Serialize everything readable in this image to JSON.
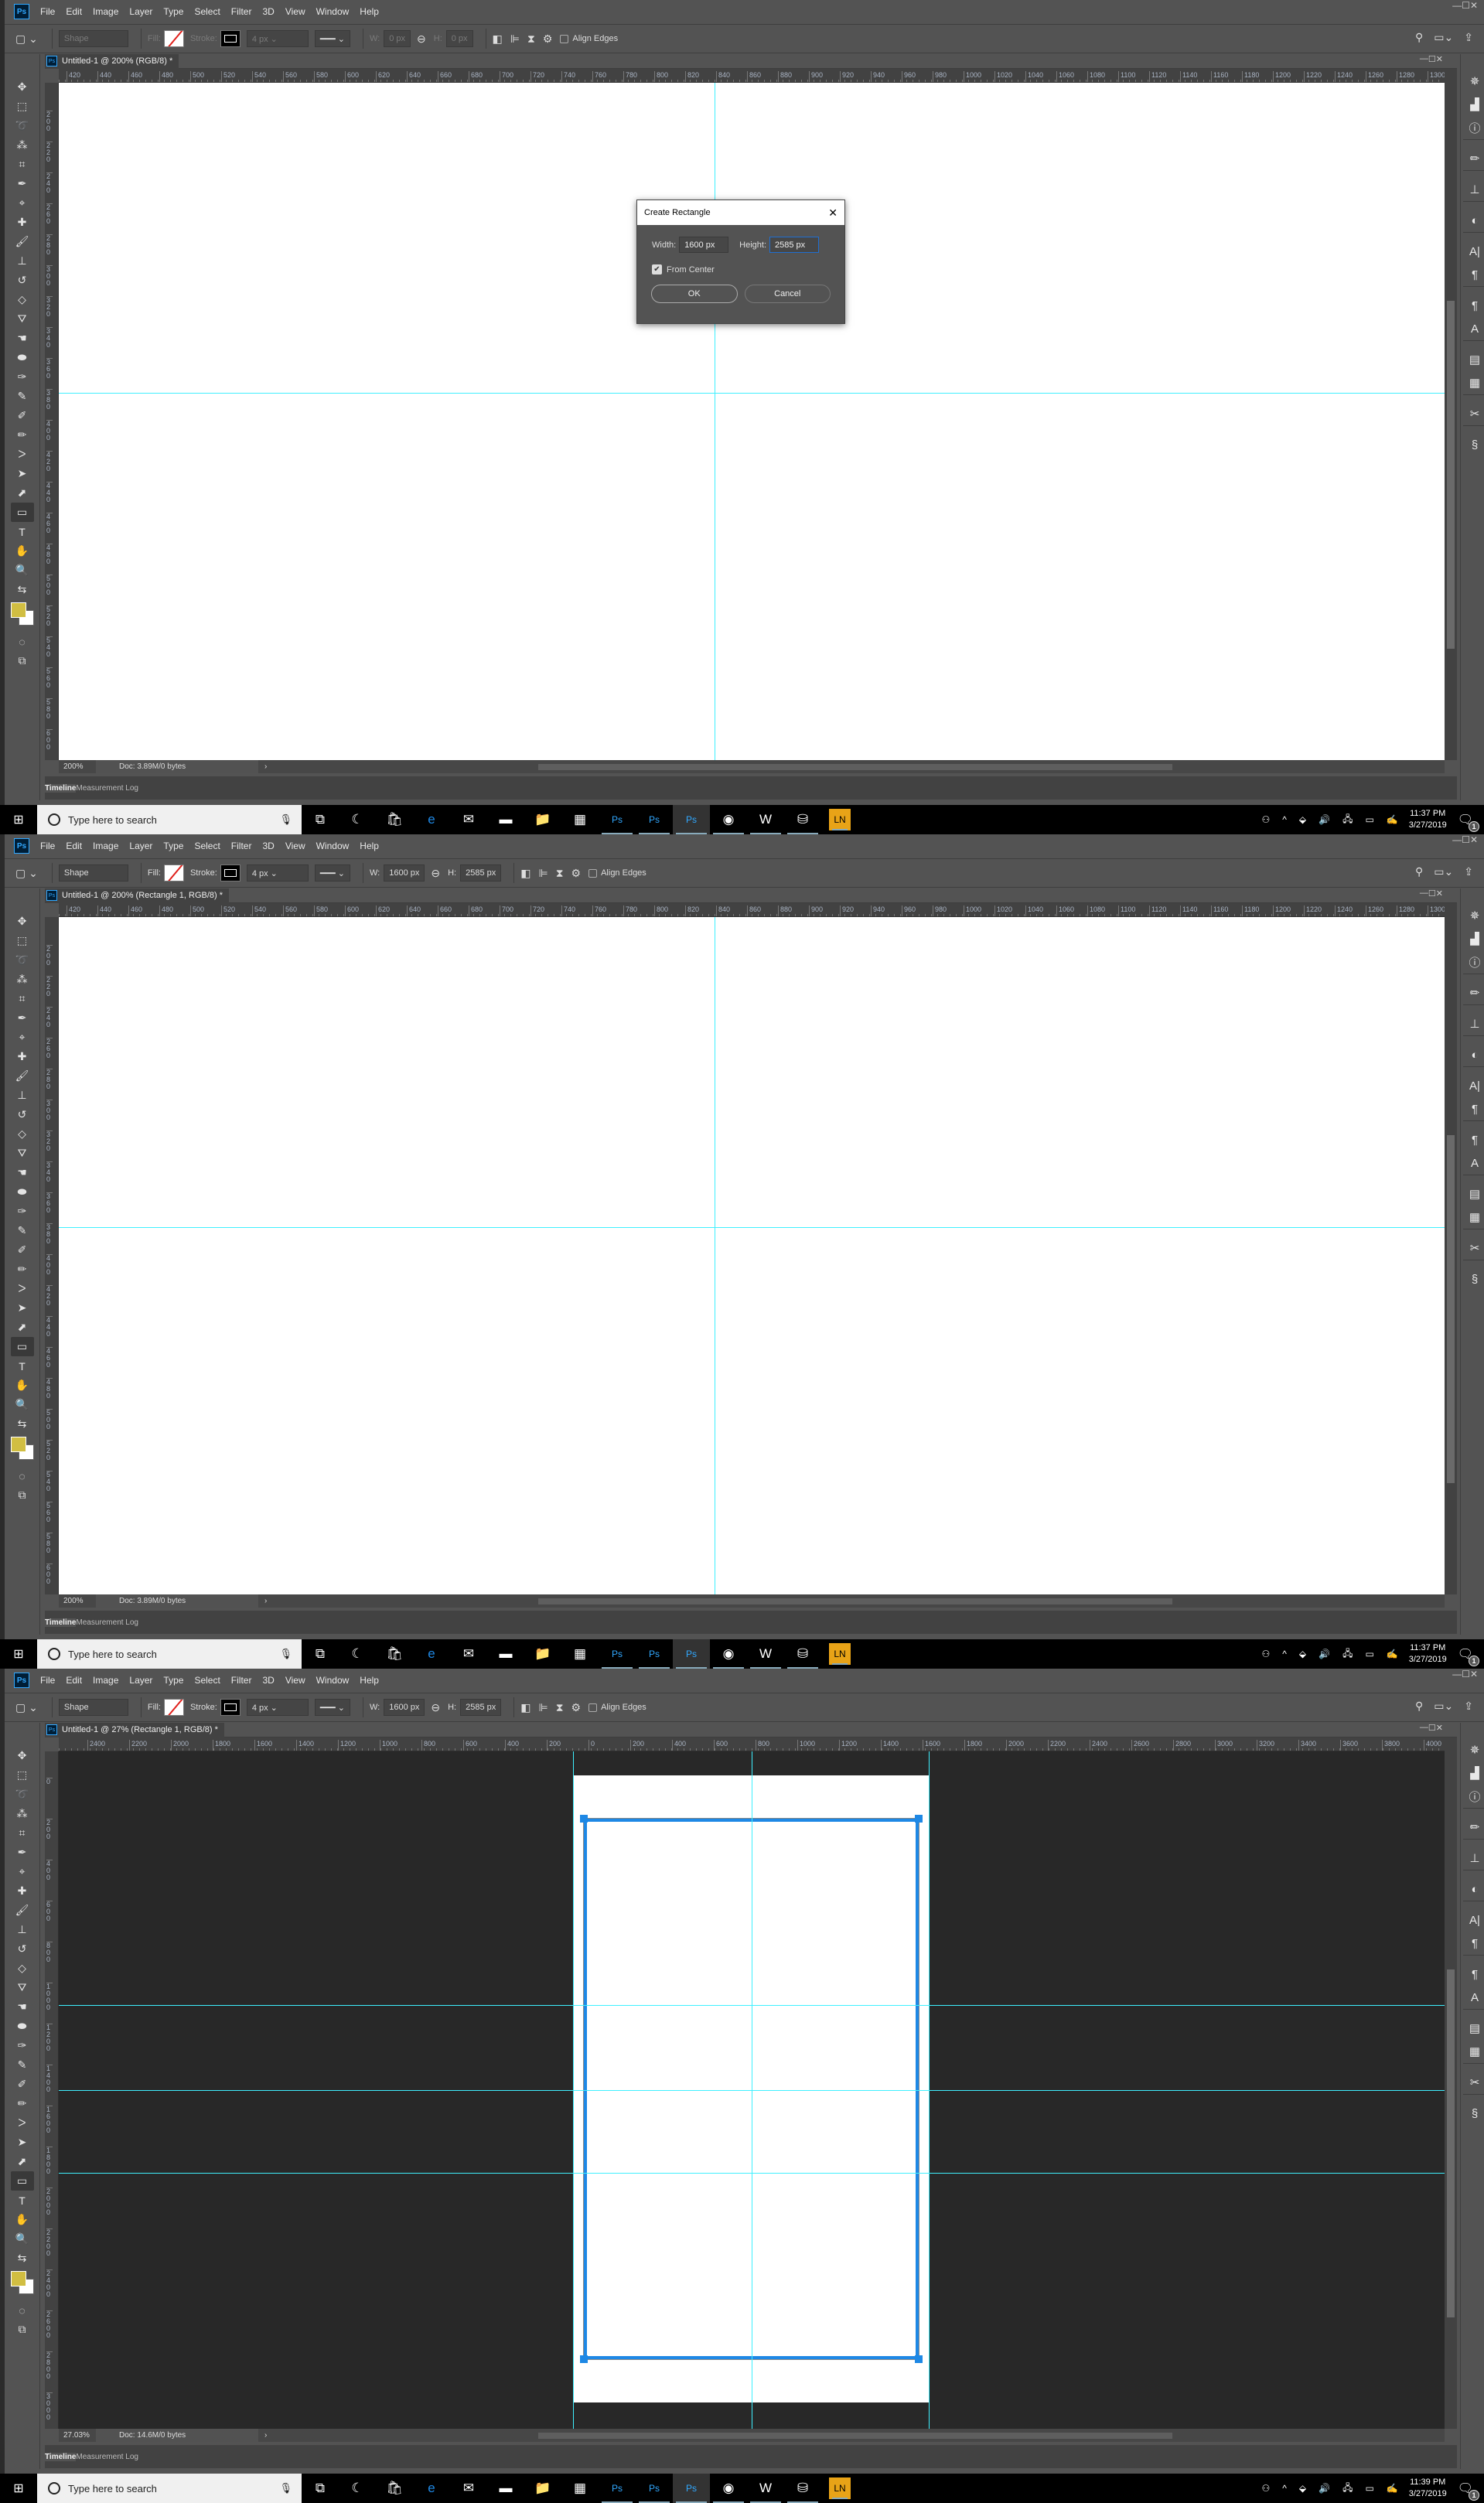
{
  "app": {
    "menu": [
      "File",
      "Edit",
      "Image",
      "Layer",
      "Type",
      "Select",
      "Filter",
      "3D",
      "View",
      "Window",
      "Help"
    ],
    "logo": "Ps",
    "options": {
      "fill_label": "Fill:",
      "stroke_label": "Stroke:",
      "w_label": "W:",
      "h_label": "H:",
      "align_edges": "Align Edges"
    },
    "tools": [
      {
        "icon": "move-icon",
        "glyph": "✥"
      },
      {
        "icon": "rectangular-marquee-icon",
        "glyph": "⬚"
      },
      {
        "icon": "lasso-icon",
        "glyph": "➰"
      },
      {
        "icon": "magic-wand-icon",
        "glyph": "⁂"
      },
      {
        "icon": "crop-icon",
        "glyph": "⌗"
      },
      {
        "icon": "eyedropper-icon",
        "glyph": "✒"
      },
      {
        "icon": "color-sampler-icon",
        "glyph": "⌖"
      },
      {
        "icon": "healing-brush-icon",
        "glyph": "✚"
      },
      {
        "icon": "brush-icon",
        "glyph": "🖌"
      },
      {
        "icon": "clone-stamp-icon",
        "glyph": "⊥"
      },
      {
        "icon": "history-brush-icon",
        "glyph": "↺"
      },
      {
        "icon": "eraser-icon",
        "glyph": "◇"
      },
      {
        "icon": "paint-bucket-icon",
        "glyph": "⛛"
      },
      {
        "icon": "smudge-icon",
        "glyph": "☚"
      },
      {
        "icon": "sponge-icon",
        "glyph": "⬬"
      },
      {
        "icon": "pen-icon",
        "glyph": "✑"
      },
      {
        "icon": "freeform-pen-icon",
        "glyph": "✎"
      },
      {
        "icon": "add-anchor-icon",
        "glyph": "✐"
      },
      {
        "icon": "delete-anchor-icon",
        "glyph": "✏"
      },
      {
        "icon": "convert-point-icon",
        "glyph": "ᐳ"
      },
      {
        "icon": "path-selection-icon",
        "glyph": "➤"
      },
      {
        "icon": "direct-selection-icon",
        "glyph": "⬈"
      },
      {
        "icon": "rectangle-tool-icon",
        "glyph": "▭",
        "active": true
      },
      {
        "icon": "type-tool-icon",
        "glyph": "T"
      },
      {
        "icon": "hand-icon",
        "glyph": "✋"
      },
      {
        "icon": "zoom-icon",
        "glyph": "🔍"
      },
      {
        "icon": "swap-colors-icon",
        "glyph": "⇆"
      }
    ],
    "extra_tools": [
      {
        "icon": "quick-mask-icon",
        "glyph": "◌"
      },
      {
        "icon": "screen-mode-icon",
        "glyph": "⧉"
      }
    ],
    "colors": {
      "foreground": "#d1be42",
      "background": "#ffffff",
      "guide": "#3ff0ff",
      "path": "#1e88e5",
      "ui": "#535353",
      "pasteboard": "#282828"
    },
    "dock": [
      [
        "navigator-icon",
        "✵"
      ],
      [
        "histogram-icon",
        "▟"
      ],
      [
        "info-icon",
        "ⓘ"
      ],
      null,
      [
        "brush-presets-icon",
        "✏"
      ],
      null,
      [
        "clone-source-icon",
        "⊥"
      ],
      null,
      [
        "adjustments-icon",
        "◐"
      ],
      null,
      [
        "character-icon",
        "A|"
      ],
      [
        "paragraph-icon",
        "¶"
      ],
      null,
      [
        "paragraph-styles-icon",
        "¶"
      ],
      [
        "character-styles-icon",
        "A"
      ],
      null,
      [
        "libraries-icon",
        "▤"
      ],
      [
        "notes-icon",
        "▦"
      ],
      null,
      [
        "tool-presets-icon",
        "✂"
      ],
      null,
      [
        "history-icon",
        "§"
      ]
    ],
    "timeline_tabs": [
      "Timeline",
      "Measurement Log"
    ]
  },
  "taskbar": {
    "search_placeholder": "Type here to search",
    "apps": [
      "task-view",
      "cortana-app",
      "store",
      "edge",
      "mail",
      "terminal",
      "file-explorer",
      "calculator",
      "photoshop-1",
      "photoshop-2",
      "photoshop-3",
      "chrome",
      "word-app",
      "network-app",
      "lightroom"
    ],
    "tray": [
      "people",
      "show-hidden",
      "dropbox",
      "volume",
      "network",
      "battery",
      "pen"
    ],
    "notification_count": "1"
  },
  "shots": [
    {
      "doc_title": "Untitled-1 @ 200% (RGB/8) *",
      "shape_mode": "Shape",
      "stroke_width": "4 px",
      "w": "0 px",
      "h": "0 px",
      "options_disabled": true,
      "zoom": "200%",
      "doc_info": "Doc: 3.89M/0 bytes",
      "hruler": [
        "420",
        "440",
        "460",
        "480",
        "500",
        "520",
        "540",
        "560",
        "580",
        "600",
        "620",
        "640",
        "660",
        "680",
        "700",
        "720",
        "740",
        "760",
        "780",
        "800",
        "820",
        "840",
        "860",
        "880",
        "900",
        "920",
        "940",
        "960",
        "980",
        "1000",
        "1020",
        "1040",
        "1060",
        "1080",
        "1100",
        "1120",
        "1140",
        "1160",
        "1180",
        "1200",
        "1220",
        "1240",
        "1260",
        "1280",
        "1300"
      ],
      "vruler": [
        "200",
        "220",
        "240",
        "260",
        "280",
        "300",
        "320",
        "340",
        "360",
        "380",
        "400",
        "420",
        "440",
        "460",
        "480",
        "500",
        "520",
        "540",
        "560",
        "580",
        "600",
        "620"
      ],
      "dialog": {
        "title": "Create Rectangle",
        "width_label": "Width:",
        "width": "1600 px",
        "height_label": "Height:",
        "height": "2585 px",
        "from_center": "From Center",
        "from_center_checked": true,
        "ok": "OK",
        "cancel": "Cancel"
      },
      "time": "11:37 PM",
      "date": "3/27/2019"
    },
    {
      "doc_title": "Untitled-1 @ 200% (Rectangle 1, RGB/8) *",
      "shape_mode": "Shape",
      "stroke_width": "4 px",
      "w": "1600 px",
      "h": "2585 px",
      "options_disabled": false,
      "zoom": "200%",
      "doc_info": "Doc: 3.89M/0 bytes",
      "hruler": [
        "420",
        "440",
        "460",
        "480",
        "500",
        "520",
        "540",
        "560",
        "580",
        "600",
        "620",
        "640",
        "660",
        "680",
        "700",
        "720",
        "740",
        "760",
        "780",
        "800",
        "820",
        "840",
        "860",
        "880",
        "900",
        "920",
        "940",
        "960",
        "980",
        "1000",
        "1020",
        "1040",
        "1060",
        "1080",
        "1100",
        "1120",
        "1140",
        "1160",
        "1180",
        "1200",
        "1220",
        "1240",
        "1260",
        "1280",
        "1300"
      ],
      "vruler": [
        "200",
        "220",
        "240",
        "260",
        "280",
        "300",
        "320",
        "340",
        "360",
        "380",
        "400",
        "420",
        "440",
        "460",
        "480",
        "500",
        "520",
        "540",
        "560",
        "580",
        "600",
        "620"
      ],
      "time": "11:37 PM",
      "date": "3/27/2019"
    },
    {
      "doc_title": "Untitled-1 @ 27% (Rectangle 1, RGB/8) *",
      "shape_mode": "Shape",
      "stroke_width": "4 px",
      "w": "1600 px",
      "h": "2585 px",
      "options_disabled": false,
      "zoom": "27.03%",
      "doc_info": "Doc: 14.6M/0 bytes",
      "hruler": [
        "2400",
        "2200",
        "2000",
        "1800",
        "1600",
        "1400",
        "1200",
        "1000",
        "800",
        "600",
        "400",
        "200",
        "0",
        "200",
        "400",
        "600",
        "800",
        "1000",
        "1200",
        "1400",
        "1600",
        "1800",
        "2000",
        "2200",
        "2400",
        "2600",
        "2800",
        "3000",
        "3200",
        "3400",
        "3600",
        "3800",
        "4000"
      ],
      "vruler": [
        "0",
        "200",
        "400",
        "600",
        "800",
        "1000",
        "1200",
        "1400",
        "1600",
        "1800",
        "2000",
        "2200",
        "2400",
        "2600",
        "2800",
        "3000"
      ],
      "time": "11:39 PM",
      "date": "3/27/2019"
    }
  ]
}
